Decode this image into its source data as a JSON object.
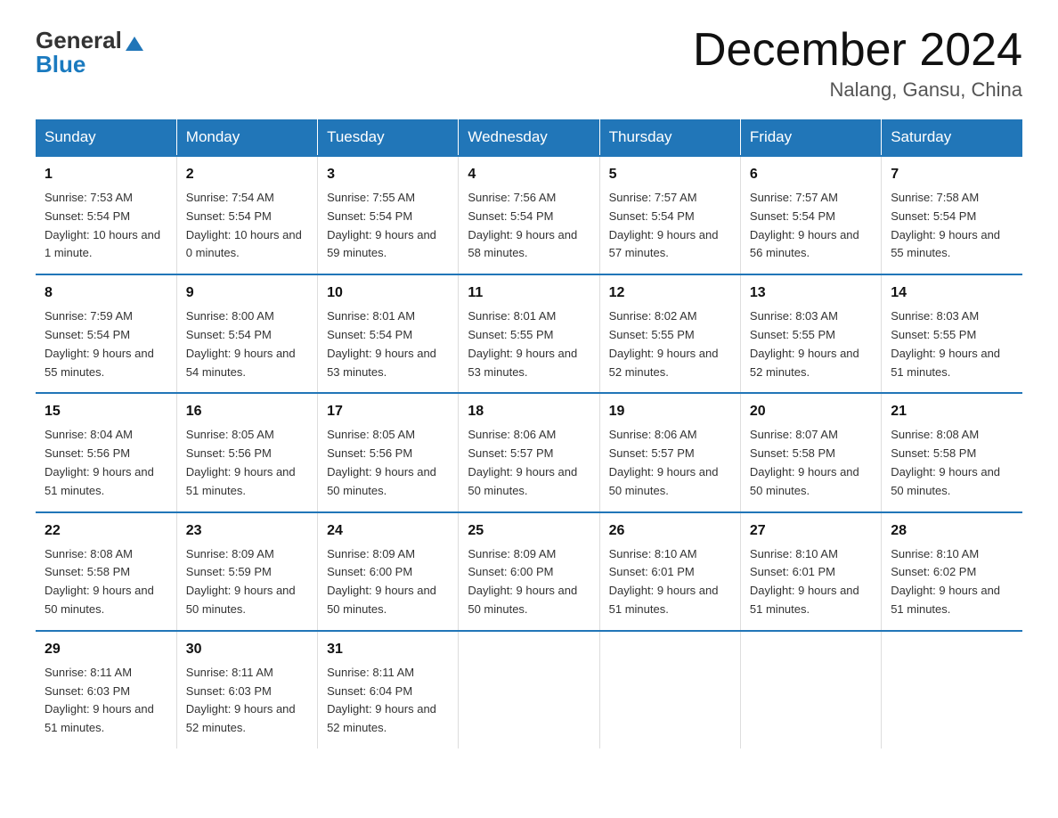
{
  "header": {
    "logo_general": "General",
    "logo_blue": "Blue",
    "month_title": "December 2024",
    "location": "Nalang, Gansu, China"
  },
  "days_of_week": [
    "Sunday",
    "Monday",
    "Tuesday",
    "Wednesday",
    "Thursday",
    "Friday",
    "Saturday"
  ],
  "weeks": [
    [
      {
        "day": "1",
        "sunrise": "7:53 AM",
        "sunset": "5:54 PM",
        "daylight": "10 hours and 1 minute."
      },
      {
        "day": "2",
        "sunrise": "7:54 AM",
        "sunset": "5:54 PM",
        "daylight": "10 hours and 0 minutes."
      },
      {
        "day": "3",
        "sunrise": "7:55 AM",
        "sunset": "5:54 PM",
        "daylight": "9 hours and 59 minutes."
      },
      {
        "day": "4",
        "sunrise": "7:56 AM",
        "sunset": "5:54 PM",
        "daylight": "9 hours and 58 minutes."
      },
      {
        "day": "5",
        "sunrise": "7:57 AM",
        "sunset": "5:54 PM",
        "daylight": "9 hours and 57 minutes."
      },
      {
        "day": "6",
        "sunrise": "7:57 AM",
        "sunset": "5:54 PM",
        "daylight": "9 hours and 56 minutes."
      },
      {
        "day": "7",
        "sunrise": "7:58 AM",
        "sunset": "5:54 PM",
        "daylight": "9 hours and 55 minutes."
      }
    ],
    [
      {
        "day": "8",
        "sunrise": "7:59 AM",
        "sunset": "5:54 PM",
        "daylight": "9 hours and 55 minutes."
      },
      {
        "day": "9",
        "sunrise": "8:00 AM",
        "sunset": "5:54 PM",
        "daylight": "9 hours and 54 minutes."
      },
      {
        "day": "10",
        "sunrise": "8:01 AM",
        "sunset": "5:54 PM",
        "daylight": "9 hours and 53 minutes."
      },
      {
        "day": "11",
        "sunrise": "8:01 AM",
        "sunset": "5:55 PM",
        "daylight": "9 hours and 53 minutes."
      },
      {
        "day": "12",
        "sunrise": "8:02 AM",
        "sunset": "5:55 PM",
        "daylight": "9 hours and 52 minutes."
      },
      {
        "day": "13",
        "sunrise": "8:03 AM",
        "sunset": "5:55 PM",
        "daylight": "9 hours and 52 minutes."
      },
      {
        "day": "14",
        "sunrise": "8:03 AM",
        "sunset": "5:55 PM",
        "daylight": "9 hours and 51 minutes."
      }
    ],
    [
      {
        "day": "15",
        "sunrise": "8:04 AM",
        "sunset": "5:56 PM",
        "daylight": "9 hours and 51 minutes."
      },
      {
        "day": "16",
        "sunrise": "8:05 AM",
        "sunset": "5:56 PM",
        "daylight": "9 hours and 51 minutes."
      },
      {
        "day": "17",
        "sunrise": "8:05 AM",
        "sunset": "5:56 PM",
        "daylight": "9 hours and 50 minutes."
      },
      {
        "day": "18",
        "sunrise": "8:06 AM",
        "sunset": "5:57 PM",
        "daylight": "9 hours and 50 minutes."
      },
      {
        "day": "19",
        "sunrise": "8:06 AM",
        "sunset": "5:57 PM",
        "daylight": "9 hours and 50 minutes."
      },
      {
        "day": "20",
        "sunrise": "8:07 AM",
        "sunset": "5:58 PM",
        "daylight": "9 hours and 50 minutes."
      },
      {
        "day": "21",
        "sunrise": "8:08 AM",
        "sunset": "5:58 PM",
        "daylight": "9 hours and 50 minutes."
      }
    ],
    [
      {
        "day": "22",
        "sunrise": "8:08 AM",
        "sunset": "5:58 PM",
        "daylight": "9 hours and 50 minutes."
      },
      {
        "day": "23",
        "sunrise": "8:09 AM",
        "sunset": "5:59 PM",
        "daylight": "9 hours and 50 minutes."
      },
      {
        "day": "24",
        "sunrise": "8:09 AM",
        "sunset": "6:00 PM",
        "daylight": "9 hours and 50 minutes."
      },
      {
        "day": "25",
        "sunrise": "8:09 AM",
        "sunset": "6:00 PM",
        "daylight": "9 hours and 50 minutes."
      },
      {
        "day": "26",
        "sunrise": "8:10 AM",
        "sunset": "6:01 PM",
        "daylight": "9 hours and 51 minutes."
      },
      {
        "day": "27",
        "sunrise": "8:10 AM",
        "sunset": "6:01 PM",
        "daylight": "9 hours and 51 minutes."
      },
      {
        "day": "28",
        "sunrise": "8:10 AM",
        "sunset": "6:02 PM",
        "daylight": "9 hours and 51 minutes."
      }
    ],
    [
      {
        "day": "29",
        "sunrise": "8:11 AM",
        "sunset": "6:03 PM",
        "daylight": "9 hours and 51 minutes."
      },
      {
        "day": "30",
        "sunrise": "8:11 AM",
        "sunset": "6:03 PM",
        "daylight": "9 hours and 52 minutes."
      },
      {
        "day": "31",
        "sunrise": "8:11 AM",
        "sunset": "6:04 PM",
        "daylight": "9 hours and 52 minutes."
      },
      null,
      null,
      null,
      null
    ]
  ]
}
